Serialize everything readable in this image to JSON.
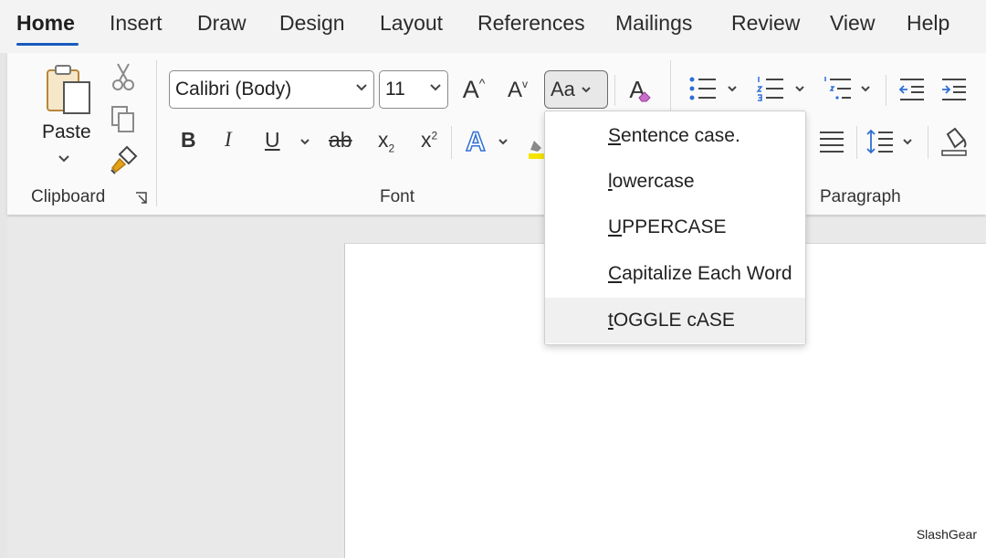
{
  "tabs": [
    "Home",
    "Insert",
    "Draw",
    "Design",
    "Layout",
    "References",
    "Mailings",
    "Review",
    "View",
    "Help"
  ],
  "active_tab": "Home",
  "clipboard": {
    "paste_label": "Paste",
    "group_label": "Clipboard"
  },
  "font": {
    "name": "Calibri (Body)",
    "size": "11",
    "group_label": "Font",
    "bold": "B",
    "italic": "I",
    "underline": "U",
    "strike": "ab",
    "subscript_base": "x",
    "subscript_mark": "2",
    "superscript_base": "x",
    "superscript_mark": "2",
    "change_case": "Aa",
    "grow": "A",
    "shrink": "A",
    "text_effects": "A",
    "clear_format": "A"
  },
  "paragraph": {
    "group_label": "Paragraph"
  },
  "change_case_menu": {
    "items": [
      {
        "accel": "S",
        "rest": "entence case."
      },
      {
        "accel": "l",
        "rest": "owercase"
      },
      {
        "accel": "U",
        "rest": "PPERCASE"
      },
      {
        "accel": "C",
        "rest": "apitalize Each Word"
      },
      {
        "accel": "t",
        "rest": "OGGLE cASE"
      }
    ],
    "hovered_index": 4
  },
  "watermark": "SlashGear",
  "colors": {
    "accent": "#185abd",
    "text_effect_blue": "#2f6fd6",
    "format_painter_yellow": "#e3a21a"
  }
}
